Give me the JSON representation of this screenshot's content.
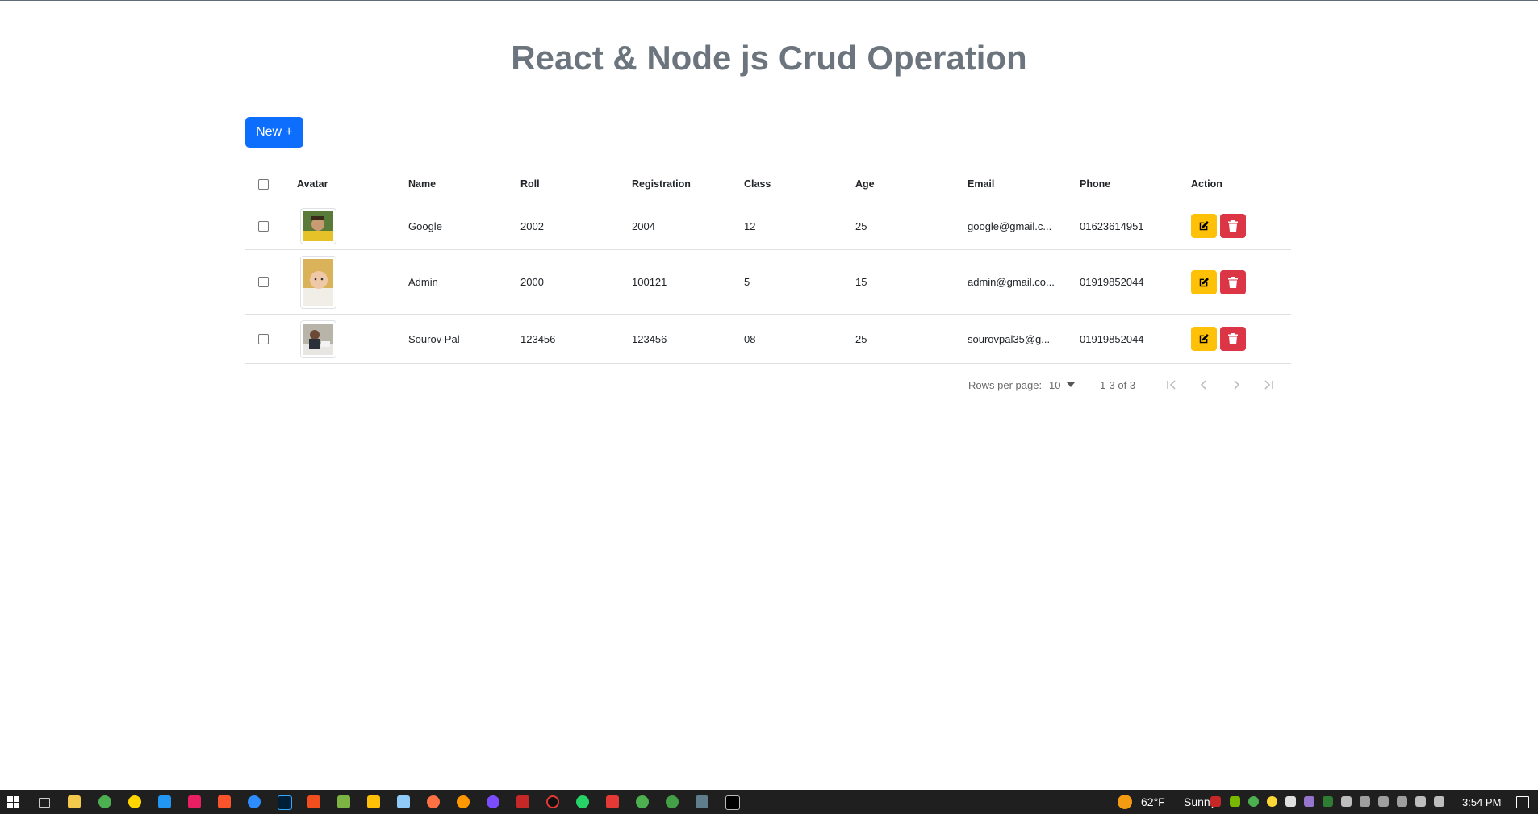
{
  "page": {
    "title": "React & Node js Crud Operation"
  },
  "toolbar": {
    "new_label": "New +"
  },
  "table": {
    "columns": [
      "Avatar",
      "Name",
      "Roll",
      "Registration",
      "Class",
      "Age",
      "Email",
      "Phone",
      "Action"
    ],
    "rows": [
      {
        "name": "Google",
        "roll": "2002",
        "registration": "2004",
        "class": "12",
        "age": "25",
        "email": "google@gmail.c...",
        "phone": "01623614951"
      },
      {
        "name": "Admin",
        "roll": "2000",
        "registration": "100121",
        "class": "5",
        "age": "15",
        "email": "admin@gmail.co...",
        "phone": "01919852044"
      },
      {
        "name": "Sourov Pal",
        "roll": "123456",
        "registration": "123456",
        "class": "08",
        "age": "25",
        "email": "sourovpal35@g...",
        "phone": "01919852044"
      }
    ]
  },
  "pagination": {
    "rows_per_page_label": "Rows per page:",
    "rows_per_page_value": "10",
    "range": "1-3 of 3"
  },
  "taskbar": {
    "weather_temp": "62°F",
    "weather_text": "Sunny",
    "time": "3:54 PM"
  },
  "colors": {
    "primary": "#0d6efd",
    "warning": "#ffc107",
    "danger": "#dc3545",
    "title": "#6c757d"
  }
}
